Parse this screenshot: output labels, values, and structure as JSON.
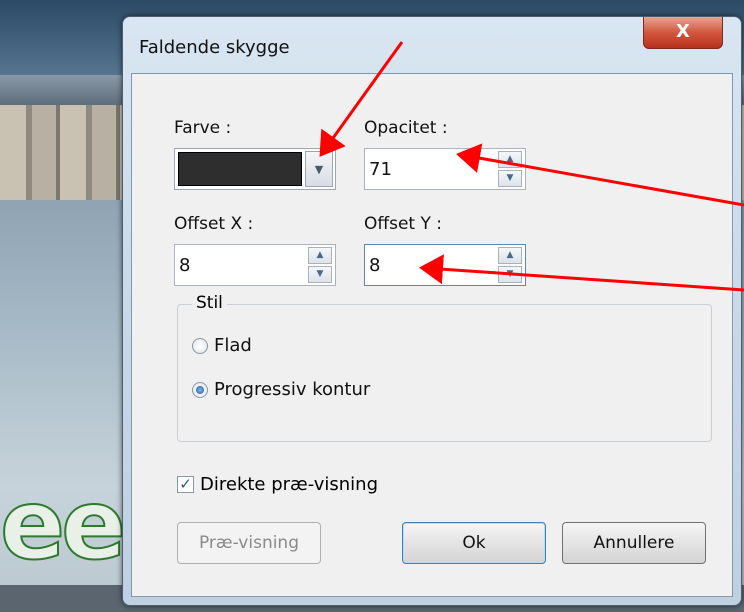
{
  "dialog": {
    "title": "Faldende skygge",
    "close_glyph": "X",
    "color_label": "Farve :",
    "color_value": "#2e2e2e",
    "opacity_label": "Opacitet :",
    "opacity_value": "71",
    "offset_x_label": "Offset X :",
    "offset_x_value": "8",
    "offset_y_label": "Offset Y :",
    "offset_y_value": "8",
    "style_group_label": "Stil",
    "style_options": [
      {
        "label": "Flad",
        "selected": false
      },
      {
        "label": "Progressiv kontur",
        "selected": true
      }
    ],
    "live_preview_label": "Direkte præ-visning",
    "live_preview_checked": true,
    "preview_button": "Præ-visning",
    "ok_button": "Ok",
    "cancel_button": "Annullere"
  },
  "icons": {
    "dropdown": "chevron-down-icon",
    "spin_up": "spin-up-icon",
    "spin_down": "spin-down-icon"
  },
  "annotation_color": "#ff0000",
  "background_logo_text": "ee"
}
